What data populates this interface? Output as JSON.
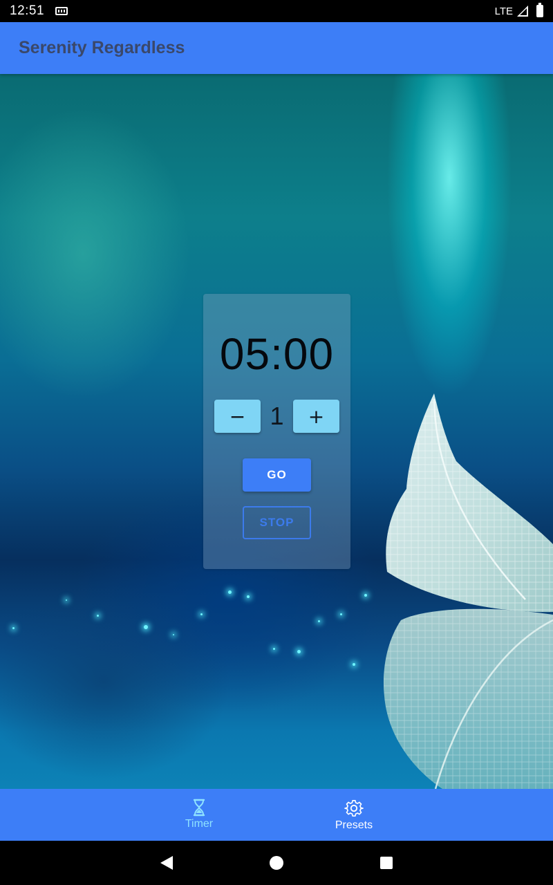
{
  "status_bar": {
    "time": "12:51",
    "network": "LTE",
    "icons": [
      "keyboard-icon",
      "signal-icon",
      "battery-icon"
    ]
  },
  "app_bar": {
    "title": "Serenity Regardless"
  },
  "timer": {
    "display": "05:00",
    "decrement_label": "−",
    "increment_label": "+",
    "step_value": "1",
    "go_label": "GO",
    "stop_label": "STOP"
  },
  "bottom_nav": {
    "items": [
      {
        "label": "Timer",
        "icon": "hourglass-icon",
        "active": true
      },
      {
        "label": "Presets",
        "icon": "gear-icon",
        "active": false
      }
    ]
  },
  "colors": {
    "primary": "#3d7ef7",
    "stepper_button": "#7fd5f5",
    "active_nav": "#8fe3ff"
  }
}
